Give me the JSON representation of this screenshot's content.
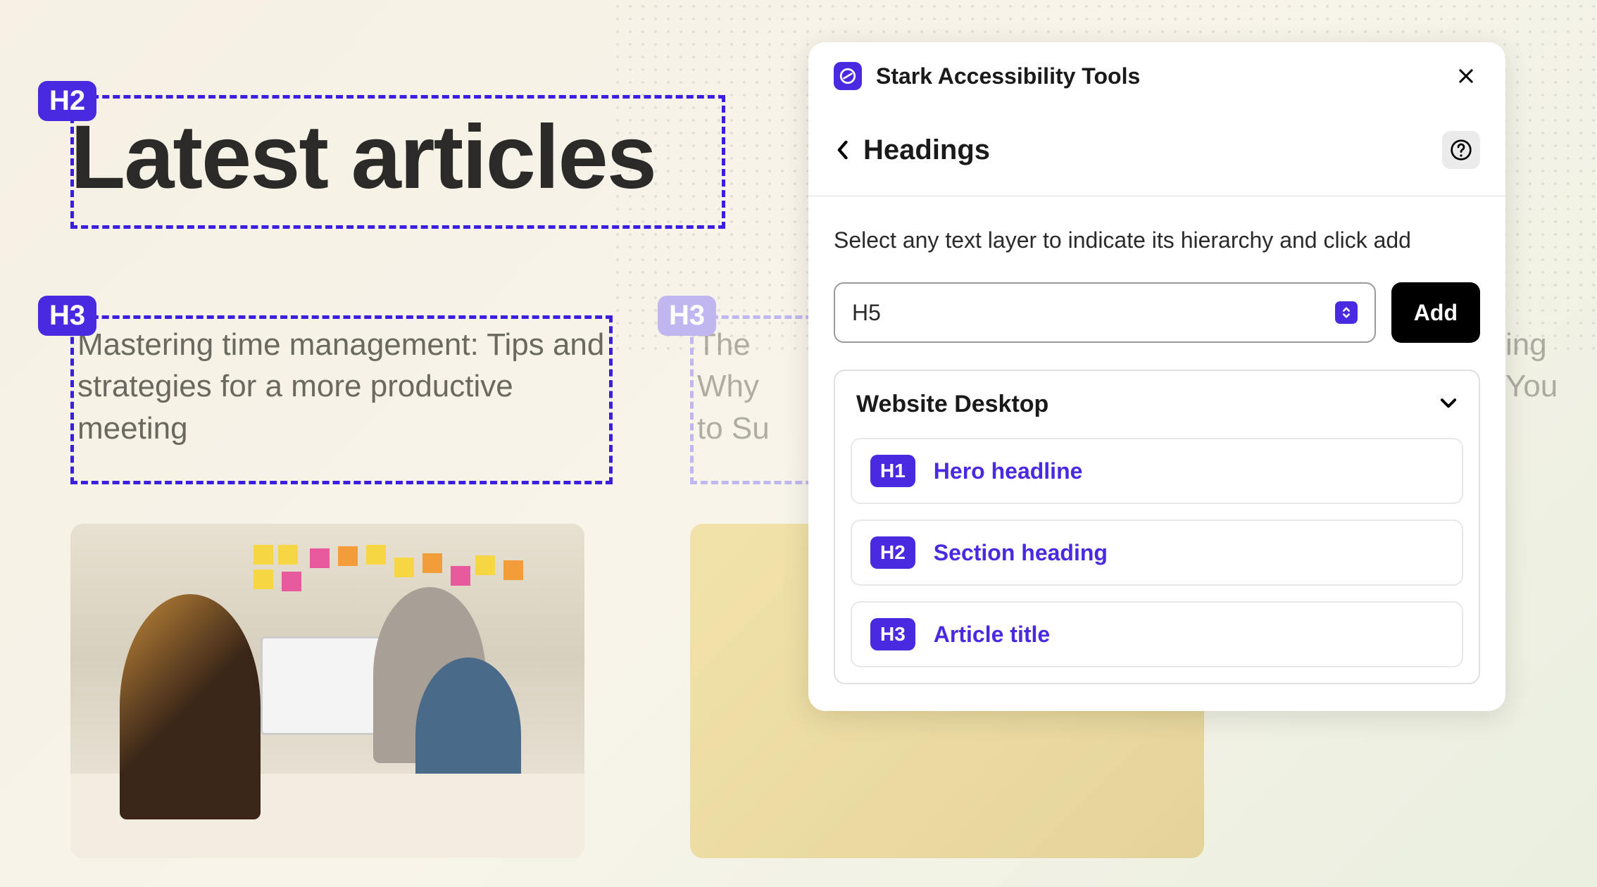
{
  "canvas": {
    "h2_badge": "H2",
    "h2_text": "Latest articles",
    "h3_badge": "H3",
    "article1_title": "Mastering time management: Tips and strategies for a more productive meeting",
    "h3_badge2": "H3",
    "article2_title_partial_lines": [
      "The",
      "Why",
      "to Su"
    ],
    "article2_right_partial_lines": [
      "ing",
      "You"
    ]
  },
  "panel": {
    "title": "Stark Accessibility Tools",
    "subheader": "Headings",
    "instruction": "Select any text layer to indicate its hierarchy and click add",
    "select_value": "H5",
    "add_label": "Add",
    "hierarchy": {
      "title": "Website Desktop",
      "items": [
        {
          "badge": "H1",
          "label": "Hero headline"
        },
        {
          "badge": "H2",
          "label": "Section heading"
        },
        {
          "badge": "H3",
          "label": "Article title"
        }
      ]
    }
  }
}
